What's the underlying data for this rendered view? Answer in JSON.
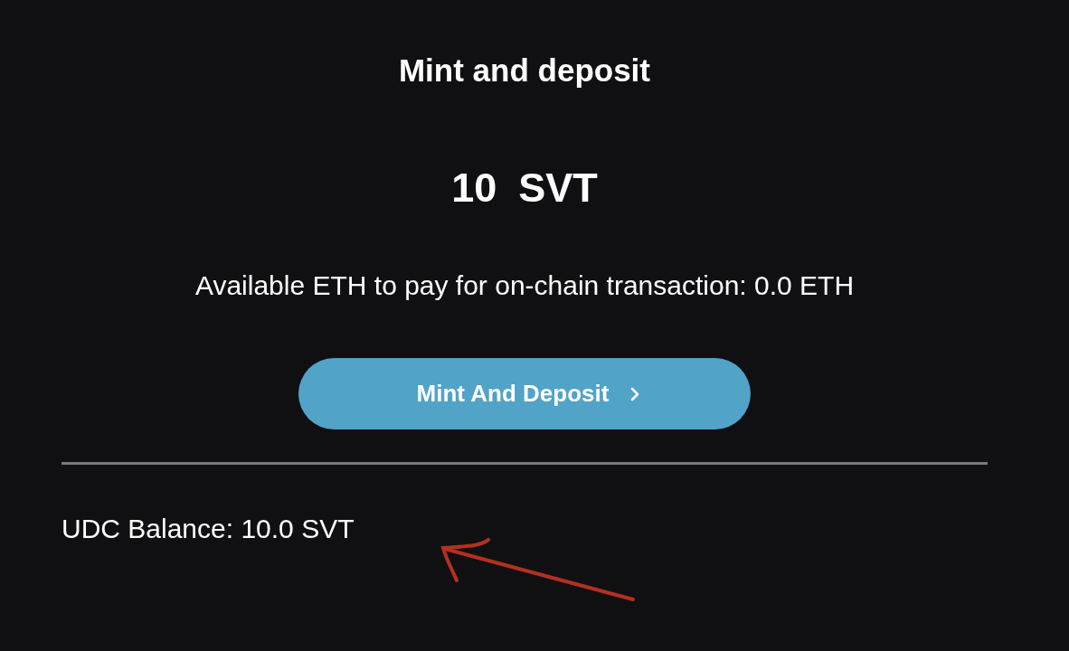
{
  "header": {
    "title": "Mint and deposit"
  },
  "amount": {
    "value": "10",
    "unit": "SVT"
  },
  "eth_notice": "Available ETH to pay for on-chain transaction: 0.0 ETH",
  "mint_button": {
    "label": "Mint And Deposit"
  },
  "udc_balance": "UDC Balance: 10.0 SVT"
}
